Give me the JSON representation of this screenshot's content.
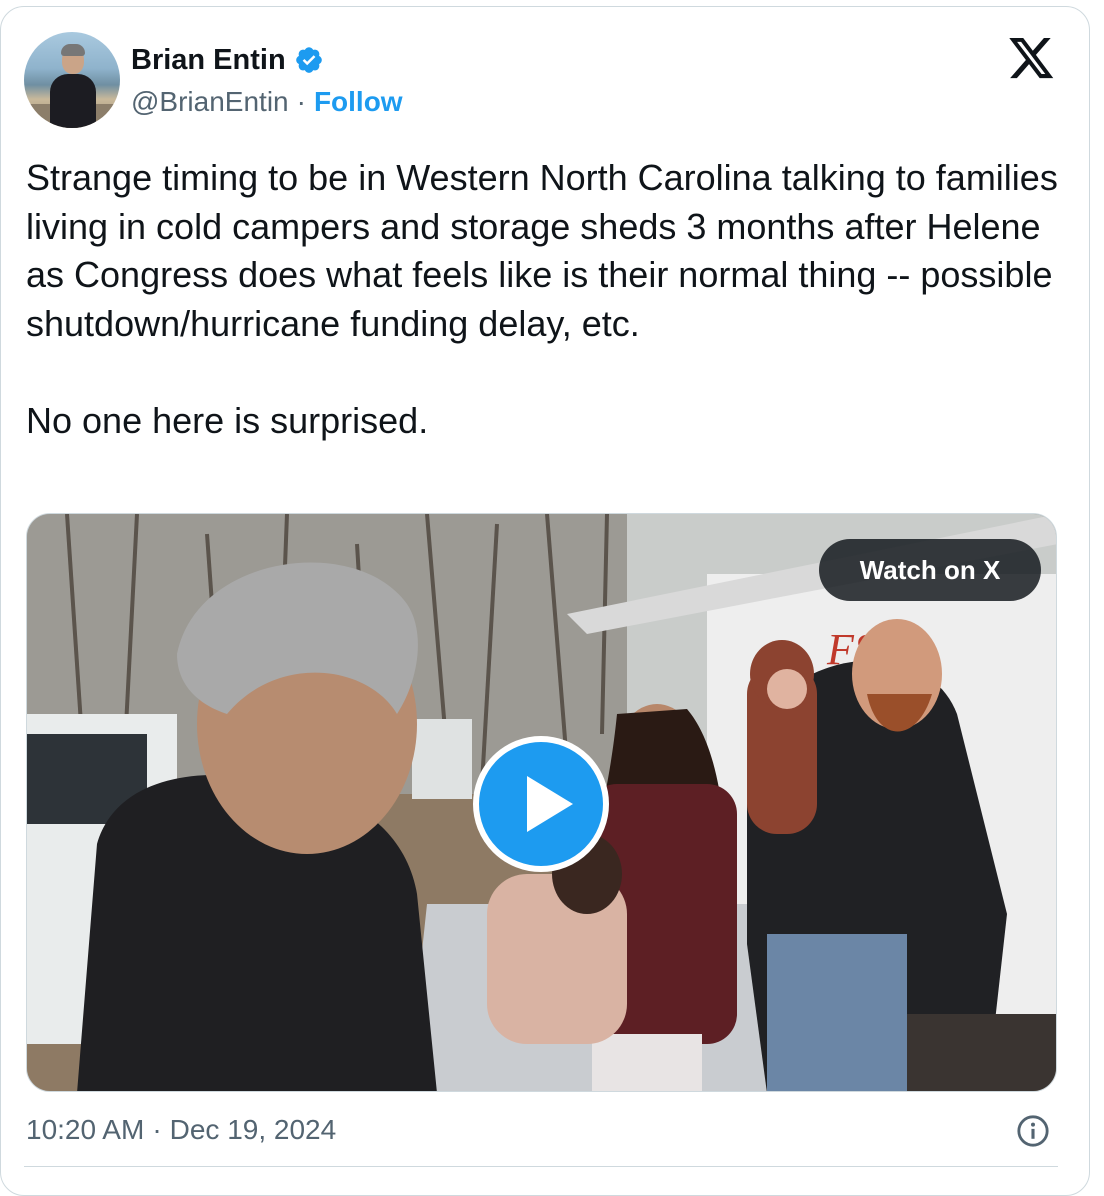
{
  "author": {
    "display_name": "Brian Entin",
    "handle": "@BrianEntin",
    "separator": "·",
    "follow_label": "Follow"
  },
  "tweet": {
    "text": "Strange timing to be in Western North Carolina talking to families living in cold campers and storage sheds 3 months after Helene as Congress does what feels like is their normal thing -- possible shutdown/hurricane funding delay, etc.\n\nNo one here is surprised."
  },
  "media": {
    "watch_label": "Watch on X"
  },
  "footer": {
    "time": "10:20 AM",
    "separator": "·",
    "date": "Dec 19, 2024"
  },
  "colors": {
    "accent": "#1d9bf0",
    "text_primary": "#0f1419",
    "text_secondary": "#536471",
    "border": "#cfd9de"
  },
  "icons": {
    "verified": "verified-badge-icon",
    "logo": "x-logo-icon",
    "play": "play-icon",
    "info": "info-icon"
  }
}
